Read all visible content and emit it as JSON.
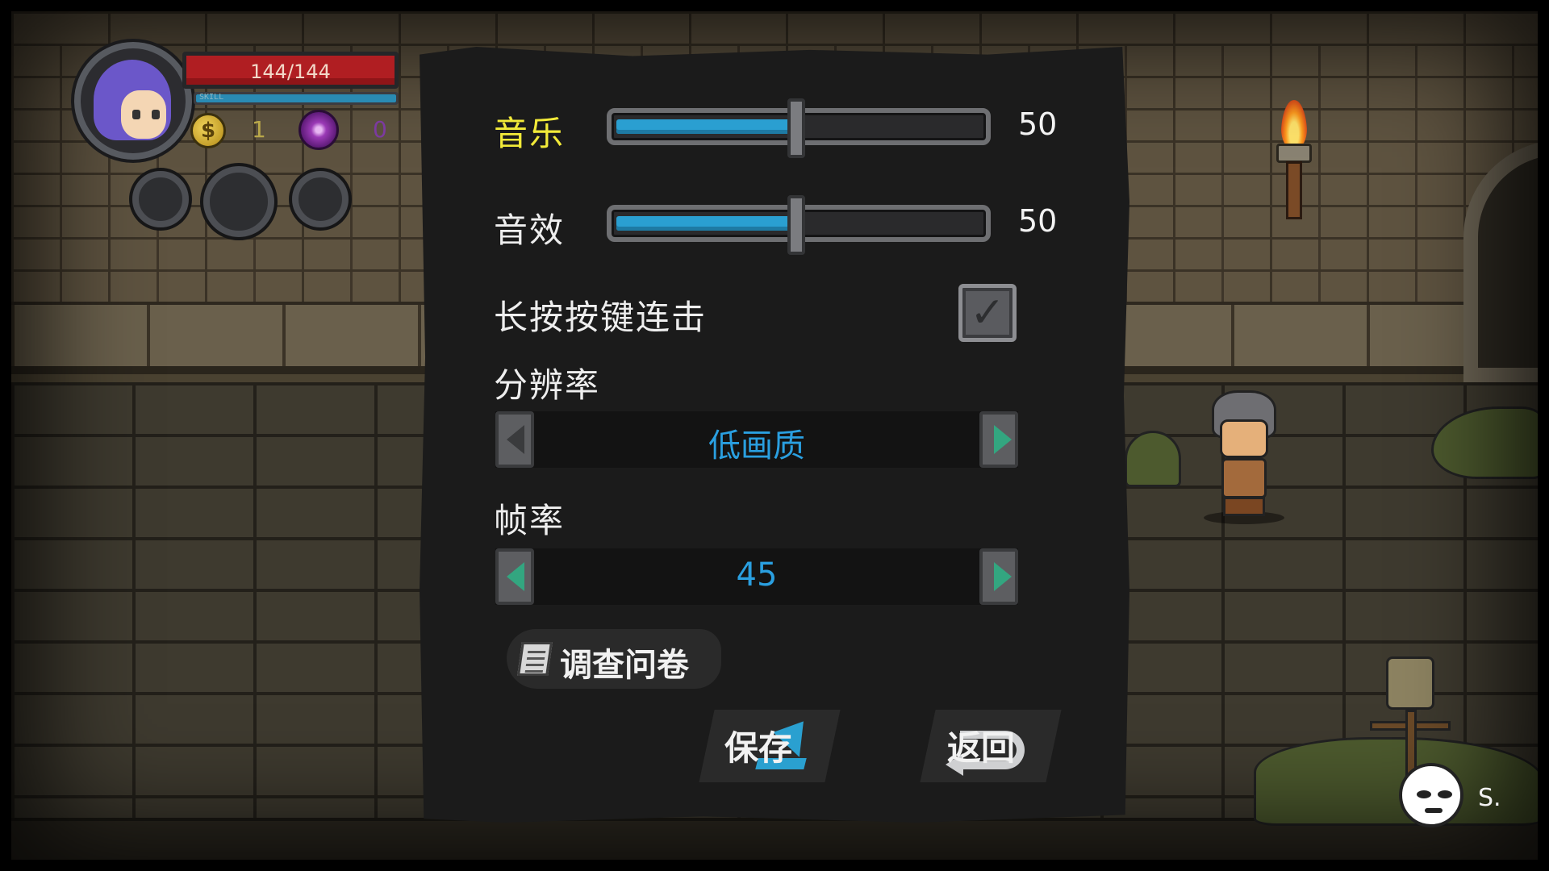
{
  "hud": {
    "hp_text": "144/144",
    "skill_label": "SKILL",
    "skill_fill_pct": 100,
    "coins": "1",
    "souls": "0",
    "coin_symbol": "$"
  },
  "settings": {
    "music": {
      "label": "音乐",
      "value": "50",
      "level_pct": 50
    },
    "sfx": {
      "label": "音效",
      "value": "50",
      "level_pct": 50
    },
    "hold_to_repeat": {
      "label": "长按按键连击",
      "checked": true,
      "check_glyph": "✓"
    },
    "resolution": {
      "label": "分辨率",
      "value": "低画质"
    },
    "framerate": {
      "label": "帧率",
      "value": "45"
    },
    "survey_label": "调查问卷",
    "save_label": "保存",
    "back_label": "返回"
  },
  "player": {
    "name": "S."
  },
  "colors": {
    "accent_blue": "#2a9fd1",
    "active_label": "#f2ea39",
    "hp_red": "#b01e22"
  }
}
